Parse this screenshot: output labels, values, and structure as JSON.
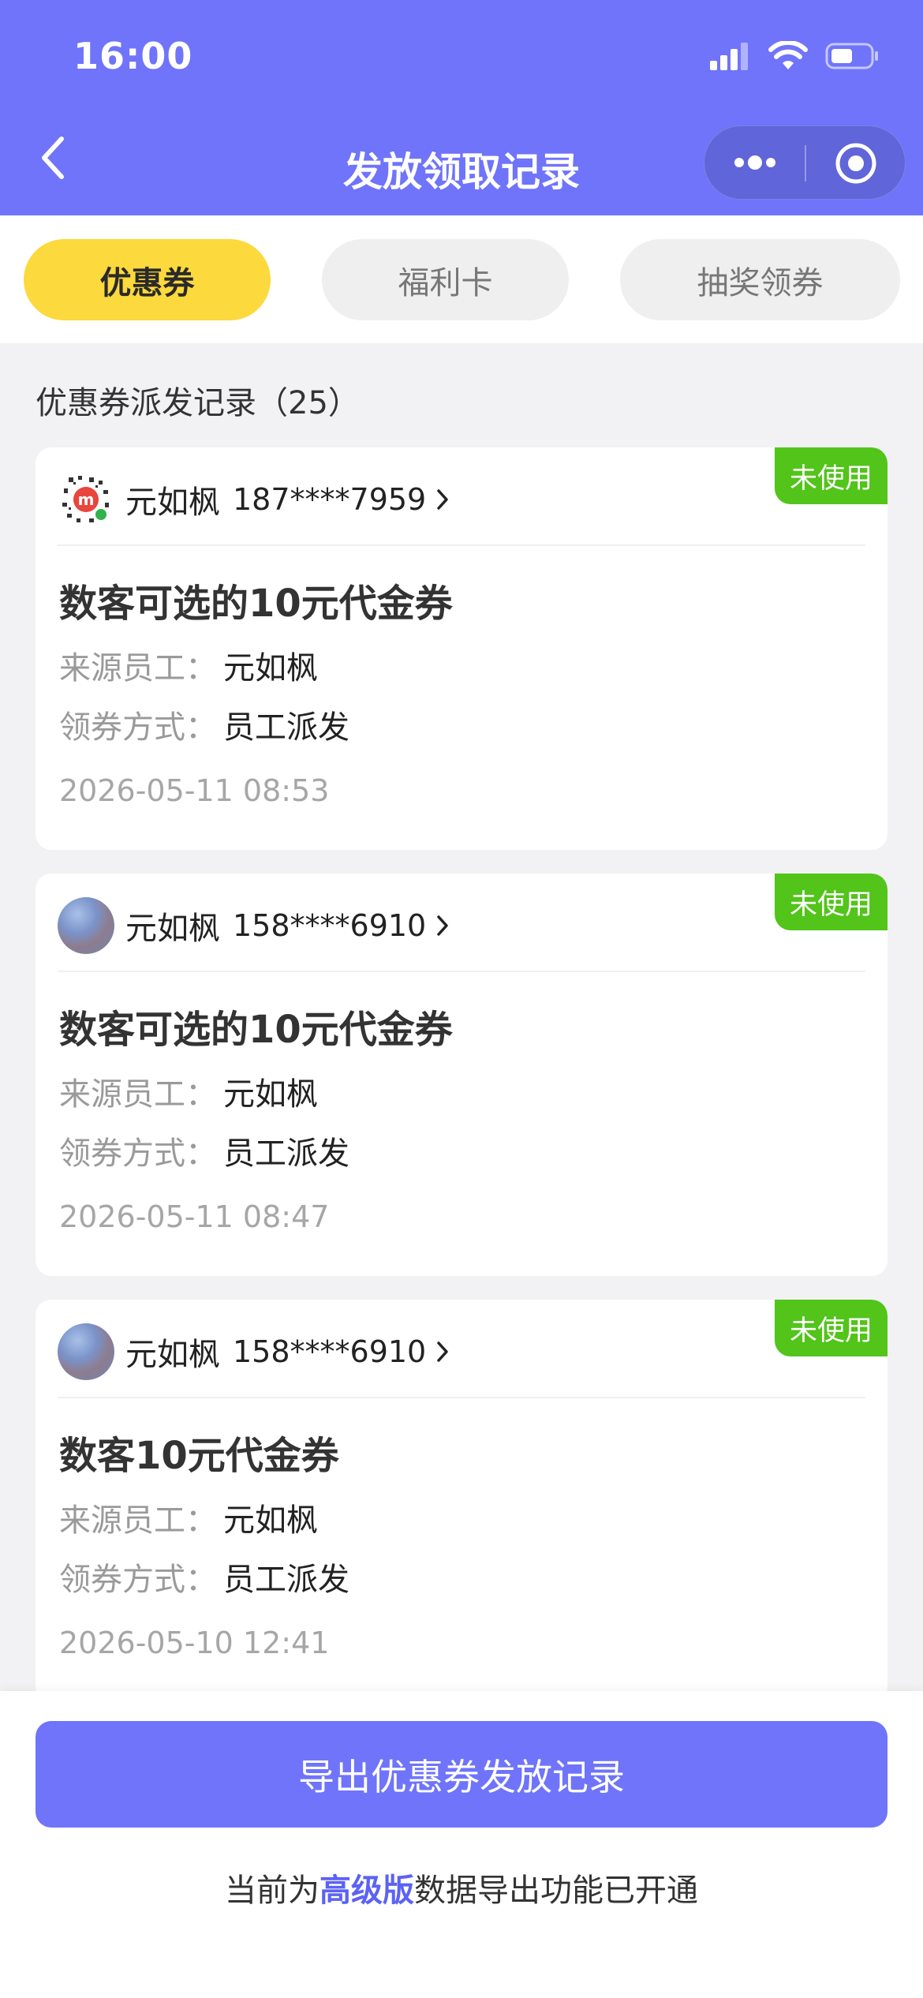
{
  "status_bar": {
    "time": "16:00"
  },
  "nav": {
    "title": "发放领取记录"
  },
  "tabs": [
    {
      "label": "优惠券",
      "active": true
    },
    {
      "label": "福利卡",
      "active": false
    },
    {
      "label": "抽奖领券",
      "active": false
    }
  ],
  "section": {
    "title": "优惠券派发记录（25）"
  },
  "records": [
    {
      "status": "未使用",
      "avatar": "qr-avatar",
      "name": "元如枫",
      "phone": "187****7959",
      "coupon_title": "数客可选的10元代金券",
      "source_label": "来源员工：",
      "source_value": "元如枫",
      "method_label": "领券方式：",
      "method_value": "员工派发",
      "time": "2026-05-11 08:53"
    },
    {
      "status": "未使用",
      "avatar": "photo-avatar",
      "name": "元如枫",
      "phone": "158****6910",
      "coupon_title": "数客可选的10元代金券",
      "source_label": "来源员工：",
      "source_value": "元如枫",
      "method_label": "领券方式：",
      "method_value": "员工派发",
      "time": "2026-05-11 08:47"
    },
    {
      "status": "未使用",
      "avatar": "photo-avatar",
      "name": "元如枫",
      "phone": "158****6910",
      "coupon_title": "数客10元代金券",
      "source_label": "来源员工：",
      "source_value": "元如枫",
      "method_label": "领券方式：",
      "method_value": "员工派发",
      "time": "2026-05-10 12:41"
    }
  ],
  "export": {
    "button_label": "导出优惠券发放记录",
    "note_prefix": "当前为",
    "note_highlight": "高级版",
    "note_suffix": "数据导出功能已开通"
  },
  "colors": {
    "primary": "#6f74fa",
    "tab_active": "#fcd93c",
    "status_green": "#52c41a",
    "highlight": "#5b62f4"
  }
}
